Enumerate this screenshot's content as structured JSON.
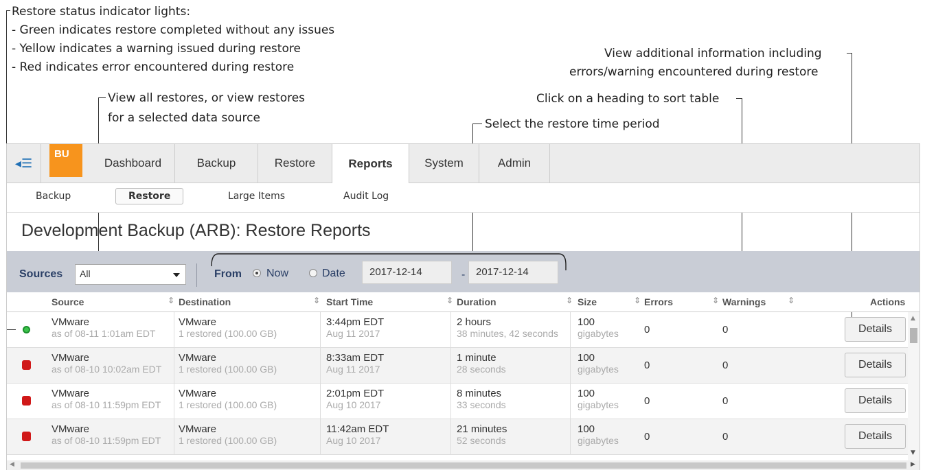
{
  "callouts": {
    "status_title": "Restore status indicator lights:",
    "status_green": "- Green indicates restore completed without any issues",
    "status_yellow": "- Yellow indicates a warning issued during restore",
    "status_red": "- Red indicates error encountered during restore",
    "sources_line1": "View all restores, or view restores",
    "sources_line2": "for a selected data source",
    "time_period": "Select the restore time period",
    "sort_heading": "Click on a heading to sort table",
    "details_line1": "View additional information including",
    "details_line2": "errors/warning encountered during restore"
  },
  "nav": {
    "badge": "BU",
    "tabs": [
      "Dashboard",
      "Backup",
      "Restore",
      "Reports",
      "System",
      "Admin"
    ],
    "active_tab": "Reports"
  },
  "subnav": {
    "items": [
      "Backup",
      "Restore",
      "Large Items",
      "Audit Log"
    ],
    "active": "Restore"
  },
  "page_title": "Development Backup (ARB): Restore Reports",
  "toolbar": {
    "sources_label": "Sources",
    "sources_value": "All",
    "from_label": "From",
    "now_label": "Now",
    "date_label": "Date",
    "date_from": "2017-12-14",
    "dash": "-",
    "date_to": "2017-12-14"
  },
  "columns": [
    "Source",
    "Destination",
    "Start Time",
    "Duration",
    "Size",
    "Errors",
    "Warnings",
    "Actions"
  ],
  "rows": [
    {
      "status": "green",
      "source": "VMware",
      "source_sub": "as of 08-11 1:01am EDT",
      "dest": "VMware",
      "dest_sub": "1 restored (100.00 GB)",
      "start": "3:44pm EDT",
      "start_sub": "Aug 11 2017",
      "duration": "2 hours",
      "duration_sub": "38 minutes, 42 seconds",
      "size": "100",
      "size_sub": "gigabytes",
      "errors": "0",
      "warnings": "0",
      "action": "Details"
    },
    {
      "status": "red",
      "source": "VMware",
      "source_sub": "as of 08-10 10:02am EDT",
      "dest": "VMware",
      "dest_sub": "1 restored (100.00 GB)",
      "start": "8:33am EDT",
      "start_sub": "Aug 11 2017",
      "duration": "1 minute",
      "duration_sub": "28 seconds",
      "size": "100",
      "size_sub": "gigabytes",
      "errors": "0",
      "warnings": "0",
      "action": "Details"
    },
    {
      "status": "red",
      "source": "VMware",
      "source_sub": "as of 08-10 11:59pm EDT",
      "dest": "VMware",
      "dest_sub": "1 restored (100.00 GB)",
      "start": "2:01pm EDT",
      "start_sub": "Aug 10 2017",
      "duration": "8 minutes",
      "duration_sub": "33 seconds",
      "size": "100",
      "size_sub": "gigabytes",
      "errors": "0",
      "warnings": "0",
      "action": "Details"
    },
    {
      "status": "red",
      "source": "VMware",
      "source_sub": "as of 08-10 11:59pm EDT",
      "dest": "VMware",
      "dest_sub": "1 restored (100.00 GB)",
      "start": "11:42am EDT",
      "start_sub": "Aug 10 2017",
      "duration": "21 minutes",
      "duration_sub": "52 seconds",
      "size": "100",
      "size_sub": "gigabytes",
      "errors": "0",
      "warnings": "0",
      "action": "Details"
    }
  ],
  "colors": {
    "accent_orange": "#f7941d",
    "status_green": "#3bc24a",
    "status_red": "#d01818",
    "toolbar_bg": "#c9cdd6"
  }
}
